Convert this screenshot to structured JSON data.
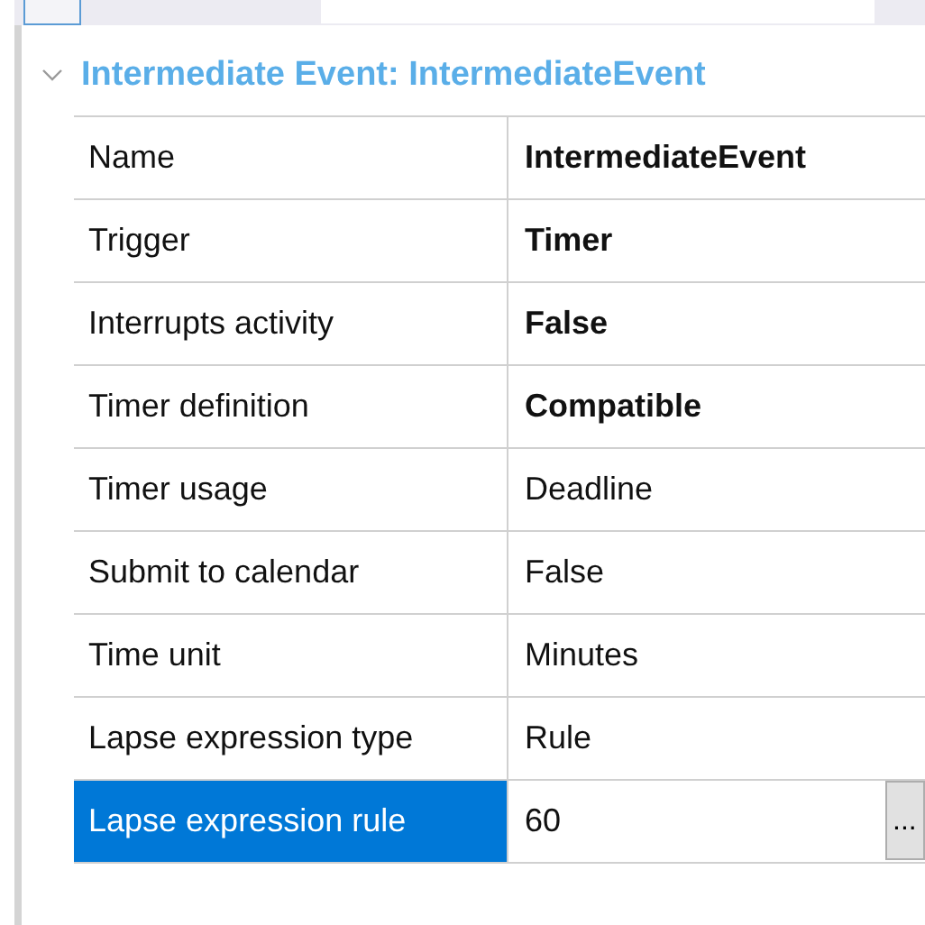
{
  "section": {
    "title": "Intermediate Event: IntermediateEvent",
    "expanded": true
  },
  "properties": [
    {
      "name": "Name",
      "value": "IntermediateEvent",
      "bold": true,
      "selected": false
    },
    {
      "name": "Trigger",
      "value": "Timer",
      "bold": true,
      "selected": false
    },
    {
      "name": "Interrupts activity",
      "value": "False",
      "bold": true,
      "selected": false
    },
    {
      "name": "Timer definition",
      "value": "Compatible",
      "bold": true,
      "selected": false
    },
    {
      "name": "Timer usage",
      "value": "Deadline",
      "bold": false,
      "selected": false
    },
    {
      "name": "Submit to calendar",
      "value": "False",
      "bold": false,
      "selected": false
    },
    {
      "name": "Time unit",
      "value": "Minutes",
      "bold": false,
      "selected": false
    },
    {
      "name": "Lapse expression type",
      "value": "Rule",
      "bold": false,
      "selected": false
    },
    {
      "name": "Lapse expression rule",
      "value": "60",
      "bold": false,
      "selected": true,
      "button": "..."
    }
  ]
}
